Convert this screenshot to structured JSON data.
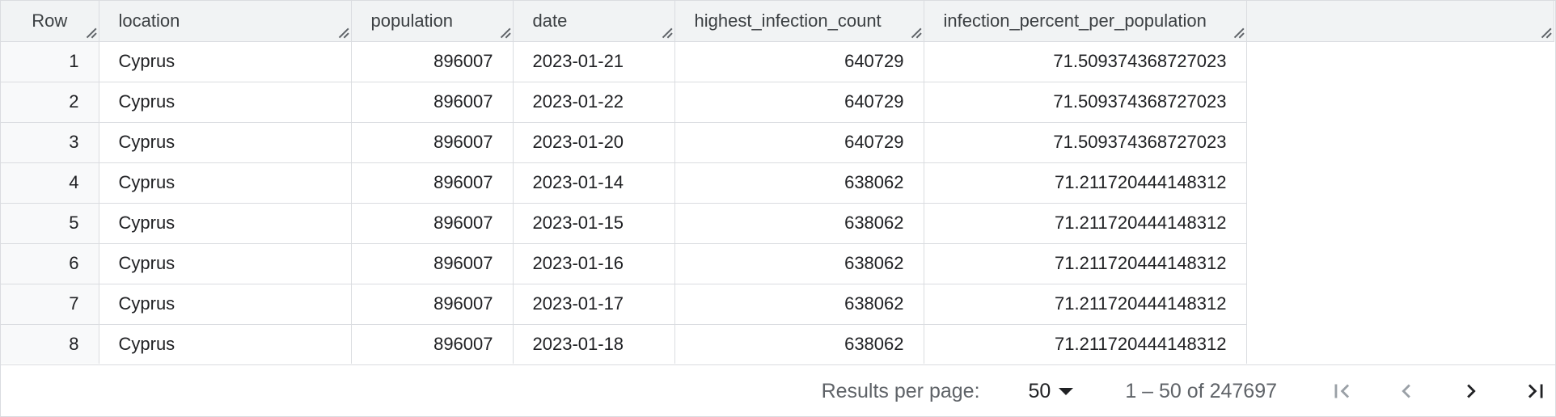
{
  "table": {
    "columns": [
      "Row",
      "location",
      "population",
      "date",
      "highest_infection_count",
      "infection_percent_per_population"
    ],
    "rows": [
      [
        "1",
        "Cyprus",
        "896007",
        "2023-01-21",
        "640729",
        "71.509374368727023"
      ],
      [
        "2",
        "Cyprus",
        "896007",
        "2023-01-22",
        "640729",
        "71.509374368727023"
      ],
      [
        "3",
        "Cyprus",
        "896007",
        "2023-01-20",
        "640729",
        "71.509374368727023"
      ],
      [
        "4",
        "Cyprus",
        "896007",
        "2023-01-14",
        "638062",
        "71.211720444148312"
      ],
      [
        "5",
        "Cyprus",
        "896007",
        "2023-01-15",
        "638062",
        "71.211720444148312"
      ],
      [
        "6",
        "Cyprus",
        "896007",
        "2023-01-16",
        "638062",
        "71.211720444148312"
      ],
      [
        "7",
        "Cyprus",
        "896007",
        "2023-01-17",
        "638062",
        "71.211720444148312"
      ],
      [
        "8",
        "Cyprus",
        "896007",
        "2023-01-18",
        "638062",
        "71.211720444148312"
      ]
    ]
  },
  "pagination": {
    "results_per_page_label": "Results per page:",
    "results_per_page_value": "50",
    "range_text": "1 – 50 of 247697",
    "icons": [
      "first-page-icon",
      "previous-page-icon",
      "next-page-icon",
      "last-page-icon"
    ]
  }
}
